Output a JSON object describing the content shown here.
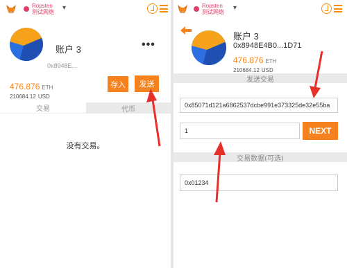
{
  "left": {
    "network": {
      "name": "Ropsten",
      "subtitle": "测试网络"
    },
    "account": {
      "name": "账户 3",
      "address": "0x8948E..."
    },
    "balance": {
      "eth": "476.876",
      "eth_unit": "ETH",
      "usd": "210684.12",
      "usd_unit": "USD"
    },
    "buttons": {
      "deposit": "存入",
      "send": "发送"
    },
    "tabs": {
      "transactions": "交易",
      "tokens": "代币"
    },
    "empty_text": "没有交易。"
  },
  "right": {
    "network": {
      "name": "Ropsten",
      "subtitle": "测试网络"
    },
    "account": {
      "name": "账户 3",
      "address": "0x8948E4B0...1D71"
    },
    "balance": {
      "eth": "476.876",
      "eth_unit": "ETH",
      "usd": "210684.12",
      "usd_unit": "USD"
    },
    "send_header": "发送交易",
    "recipient_value": "0x85071d121a6862537dcbe991e373325de32e55ba",
    "amount_value": "1",
    "next_label": "NEXT",
    "data_header": "交易数据(可选)",
    "data_value": "0x01234"
  },
  "colors": {
    "accent": "#f5821f",
    "network": "#e23f6a",
    "annotation_arrow": "#e8302a"
  },
  "icons": [
    "metamask-fox-icon",
    "network-dot-icon",
    "chevron-down-icon",
    "sync-icon",
    "hamburger-menu-icon",
    "more-icon",
    "back-arrow-icon",
    "account-avatar-icon"
  ]
}
